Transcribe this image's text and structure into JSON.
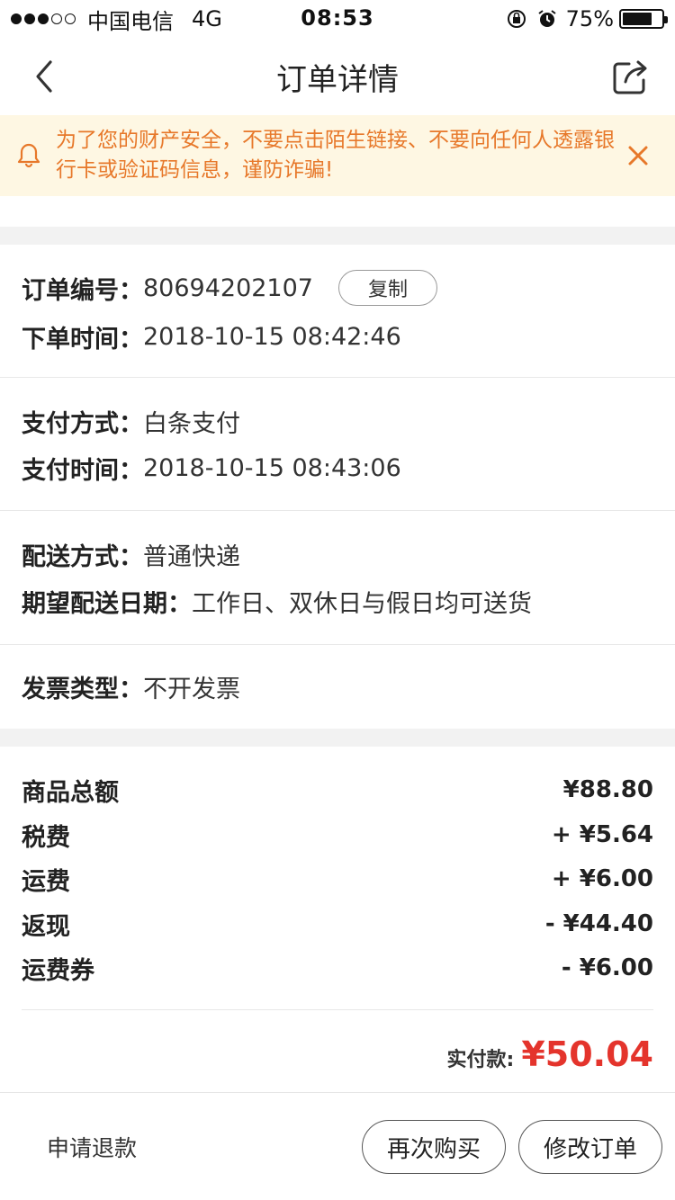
{
  "status_bar": {
    "carrier": "中国电信",
    "network": "4G",
    "time": "08:53",
    "battery": "75%",
    "battery_level": 0.75
  },
  "nav": {
    "title": "订单详情",
    "back_icon": "chevron-left-icon",
    "share_icon": "share-icon"
  },
  "warning": {
    "text": "为了您的财产安全，不要点击陌生链接、不要向任何人透露银行卡或验证码信息，谨防诈骗!",
    "color": "#e7782a",
    "background": "#fef7e3"
  },
  "order": {
    "number_label": "订单编号：",
    "number_value": "80694202107",
    "copy_label": "复制",
    "time_label": "下单时间：",
    "time_value": "2018-10-15 08:42:46"
  },
  "payment": {
    "method_label": "支付方式：",
    "method_value": "白条支付",
    "time_label": "支付时间：",
    "time_value": "2018-10-15 08:43:06"
  },
  "delivery": {
    "method_label": "配送方式：",
    "method_value": "普通快递",
    "date_label": "期望配送日期：",
    "date_value": "工作日、双休日与假日均可送货"
  },
  "invoice": {
    "type_label": "发票类型：",
    "type_value": "不开发票"
  },
  "pricing": {
    "items": [
      {
        "label": "商品总额",
        "value": "¥88.80"
      },
      {
        "label": "税费",
        "value": "+ ¥5.64"
      },
      {
        "label": "运费",
        "value": "+ ¥6.00"
      },
      {
        "label": "返现",
        "value": "- ¥44.40"
      },
      {
        "label": "运费券",
        "value": "- ¥6.00"
      }
    ],
    "paid_label": "实付款:",
    "paid_value": "¥50.04",
    "paid_color": "#e4342c"
  },
  "bottom": {
    "refund_label": "申请退款",
    "rebuy_label": "再次购买",
    "modify_label": "修改订单"
  }
}
